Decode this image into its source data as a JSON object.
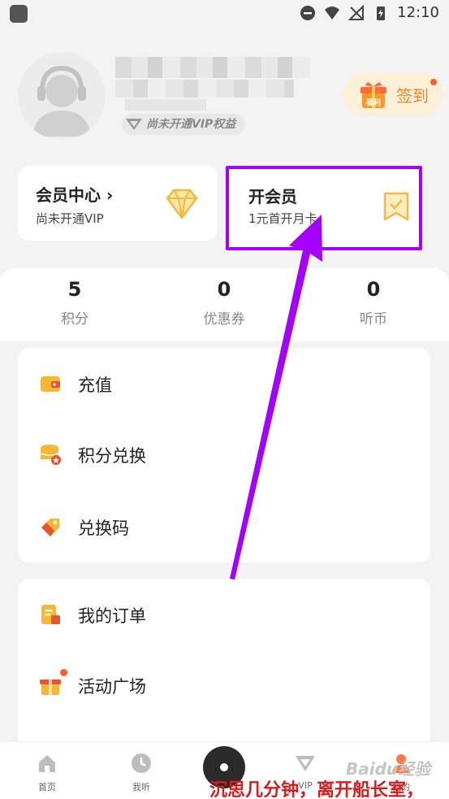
{
  "status_bar": {
    "time": "12:10"
  },
  "profile": {
    "vip_status": "尚未开通VIP权益",
    "signin_badge": "福利",
    "signin_label": "签到"
  },
  "member_center": {
    "title": "会员中心 ›",
    "subtitle": "尚未开通VIP"
  },
  "open_vip": {
    "title": "开会员",
    "subtitle": "1元首开月卡"
  },
  "stats": [
    {
      "value": "5",
      "label": "积分"
    },
    {
      "value": "0",
      "label": "优惠券"
    },
    {
      "value": "0",
      "label": "听币"
    }
  ],
  "menu1": [
    {
      "label": "充值",
      "icon": "wallet-icon"
    },
    {
      "label": "积分兑换",
      "icon": "coins-icon"
    },
    {
      "label": "兑换码",
      "icon": "tag-icon"
    }
  ],
  "menu2": [
    {
      "label": "我的订单",
      "icon": "order-icon"
    },
    {
      "label": "活动广场",
      "icon": "gift-box-icon"
    }
  ],
  "tabbar": [
    {
      "label": "首页",
      "icon": "home-icon"
    },
    {
      "label": "我听",
      "icon": "clock-icon"
    },
    {
      "label": "VIP",
      "icon": "vip-icon"
    },
    {
      "label": "我的",
      "icon": "user-icon"
    }
  ],
  "caption": "沉思几分钟，离开船长室，",
  "watermark": "Baidu经验",
  "colors": {
    "highlight": "#a400ff",
    "accent": "#f5a623",
    "caption": "#d81c1c"
  }
}
